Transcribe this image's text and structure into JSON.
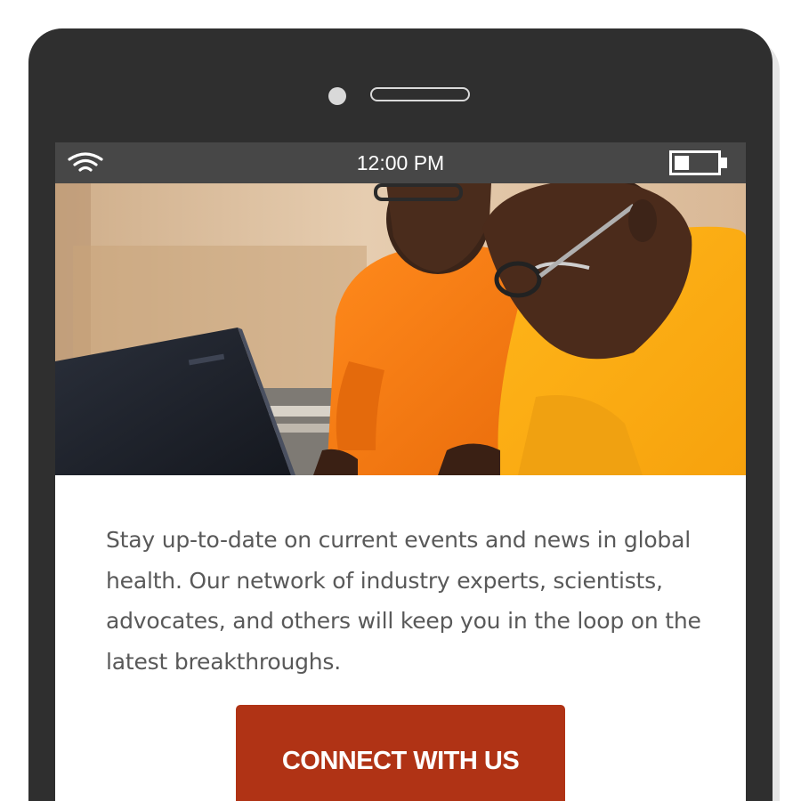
{
  "status_bar": {
    "time": "12:00 PM",
    "wifi_icon": "wifi-icon",
    "battery_icon": "battery-icon",
    "battery_level": 0.35
  },
  "hero": {
    "image": "photo-two-men-orange-shirts-laptop"
  },
  "content": {
    "body": "Stay up-to-date on current events and news in global health. Our network of industry experts, scientists, advocates, and others will keep you in the loop on the latest breakthroughs."
  },
  "cta": {
    "label": "CONNECT WITH US",
    "color": "#b03315"
  },
  "colors": {
    "device": "#2f2f2f",
    "status_bar": "#474747",
    "text": "#595959"
  }
}
